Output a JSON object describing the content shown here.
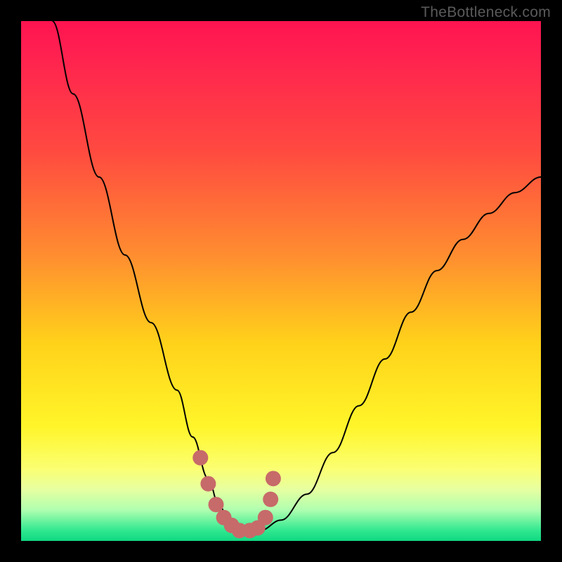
{
  "watermark": "TheBottleneck.com",
  "chart_data": {
    "type": "line",
    "title": "",
    "xlabel": "",
    "ylabel": "",
    "xlim": [
      0,
      100
    ],
    "ylim": [
      0,
      100
    ],
    "grid": false,
    "series": [
      {
        "name": "bottleneck-curve",
        "x": [
          6,
          10,
          15,
          20,
          25,
          30,
          33,
          36,
          38,
          40,
          42,
          44,
          46,
          50,
          55,
          60,
          65,
          70,
          75,
          80,
          85,
          90,
          95,
          100
        ],
        "y": [
          100,
          86,
          70,
          55,
          42,
          29,
          20,
          12,
          7,
          4,
          2,
          2,
          2,
          4,
          9,
          17,
          26,
          35,
          44,
          52,
          58,
          63,
          67,
          70
        ]
      }
    ],
    "markers": {
      "name": "highlighted-points",
      "color": "#c76a6a",
      "x": [
        34.5,
        36,
        37.5,
        39,
        40.5,
        42,
        44,
        45.5,
        47,
        48,
        48.5
      ],
      "y": [
        16,
        11,
        7,
        4.5,
        3,
        2,
        2,
        2.5,
        4.5,
        8,
        12
      ]
    },
    "background_gradient": {
      "top": "#ff1450",
      "mid1": "#ff8d30",
      "mid2": "#fff52a",
      "bottom": "#0fd880"
    }
  }
}
